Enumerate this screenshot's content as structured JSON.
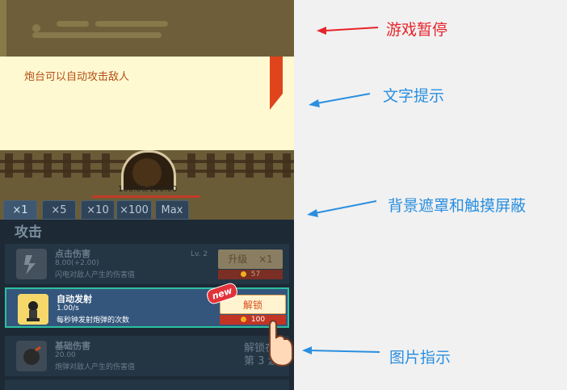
{
  "tip": {
    "text": "炮台可以自动攻击敌人"
  },
  "enemy": {
    "hp_text": "100.00/100.00",
    "hp_fraction": 1.0
  },
  "multiplier_tabs": [
    "×1",
    "×5",
    "×10",
    "×100",
    "Max"
  ],
  "panel": {
    "title": "攻击"
  },
  "upgrades": [
    {
      "name": "点击伤害",
      "value": "8.00(+2.00)",
      "desc": "闪电对敌人产生的伤害值",
      "level": "Lv. 2",
      "button": "升级",
      "button_multiplier": "×1",
      "cost": "57"
    },
    {
      "name": "自动发射",
      "value": "1.00/s",
      "desc": "每秒钟发射炮弹的次数",
      "button": "解锁",
      "cost": "100",
      "badge": "new"
    },
    {
      "name": "基础伤害",
      "value": "20.00",
      "desc": "炮弹对敌人产生的伤害值",
      "lock_line1": "解锁在",
      "lock_line2": "第 3 波"
    }
  ],
  "annotations": {
    "pause": "游戏暂停",
    "text_hint": "文字提示",
    "mask": "背景遮罩和触摸屏蔽",
    "image_hint": "图片指示"
  },
  "colors": {
    "red_arrow": "#e8232a",
    "blue_arrow": "#2a8fe0",
    "annotation_red": "#e8232a",
    "annotation_blue": "#2a8fe0",
    "accent_green": "#2cc0a0"
  }
}
